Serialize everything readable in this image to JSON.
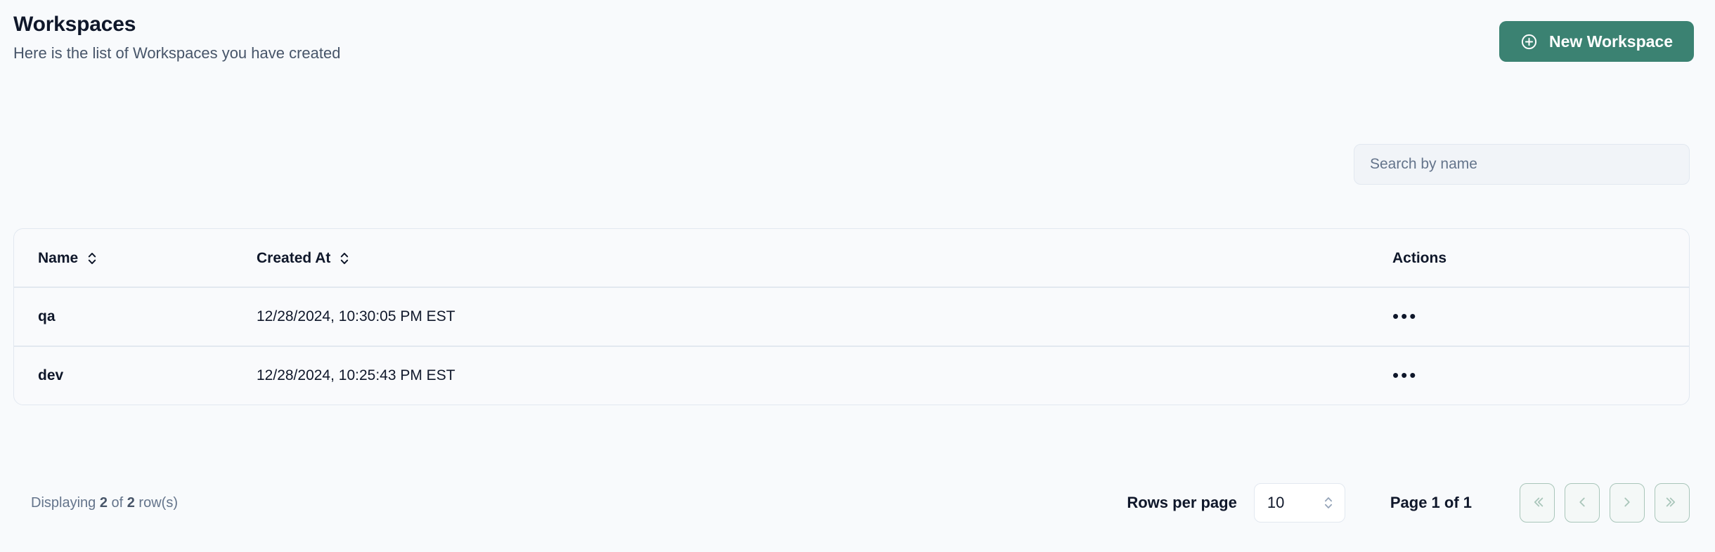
{
  "header": {
    "title": "Workspaces",
    "subtitle": "Here is the list of Workspaces you have created",
    "new_button_label": "New Workspace",
    "new_button_icon": "plus-circle-icon",
    "accent_color": "#3b8272"
  },
  "search": {
    "placeholder": "Search by name",
    "value": ""
  },
  "table": {
    "columns": [
      {
        "label": "Name",
        "sortable": true,
        "sort_icon": "chevron-up-down-icon"
      },
      {
        "label": "Created At",
        "sortable": true,
        "sort_icon": "chevron-up-down-icon"
      },
      {
        "label": "Actions",
        "sortable": false
      }
    ],
    "rows": [
      {
        "name": "qa",
        "created_at": "12/28/2024, 10:30:05 PM EST",
        "actions_icon": "ellipsis-horizontal-icon"
      },
      {
        "name": "dev",
        "created_at": "12/28/2024, 10:25:43 PM EST",
        "actions_icon": "ellipsis-horizontal-icon"
      }
    ]
  },
  "footer": {
    "displaying_prefix": "Displaying ",
    "displayed_count": "2",
    "displaying_middle": " of ",
    "total_count": "2",
    "displaying_suffix": " row(s)",
    "rows_per_page_label": "Rows per page",
    "rows_per_page_value": "10",
    "rows_per_page_icon": "chevron-up-down-icon",
    "page_indicator": "Page 1 of 1",
    "nav": [
      {
        "name": "first-page",
        "icon": "chevron-double-left-icon"
      },
      {
        "name": "previous-page",
        "icon": "chevron-left-icon"
      },
      {
        "name": "next-page",
        "icon": "chevron-right-icon"
      },
      {
        "name": "last-page",
        "icon": "chevron-double-right-icon"
      }
    ],
    "nav_border_color": "#a9c6ba"
  }
}
